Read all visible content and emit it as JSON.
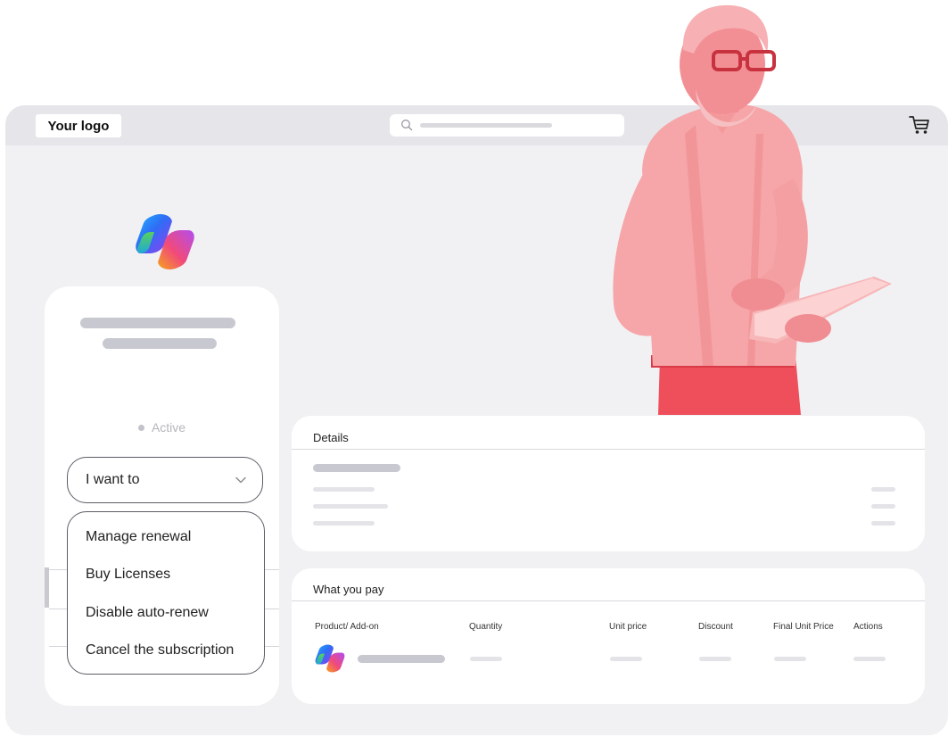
{
  "header": {
    "logo_text": "Your logo"
  },
  "status": {
    "label": "Active"
  },
  "dropdown": {
    "label": "I want to",
    "items": [
      "Manage renewal",
      "Buy Licenses",
      "Disable auto-renew",
      "Cancel the subscription"
    ]
  },
  "details": {
    "title": "Details"
  },
  "payment": {
    "title": "What you pay",
    "columns": [
      "Product/ Add-on",
      "Quantity",
      "Unit price",
      "Discount",
      "Final Unit Price",
      "Actions"
    ]
  },
  "icons": {
    "search": "search-icon",
    "cart": "cart-icon",
    "chevron": "chevron-down-icon",
    "product": "copilot-logo-icon"
  },
  "colors": {
    "background": "#f1f1f4",
    "topbar": "#e6e6ea",
    "accent_person": "#f0707a"
  }
}
